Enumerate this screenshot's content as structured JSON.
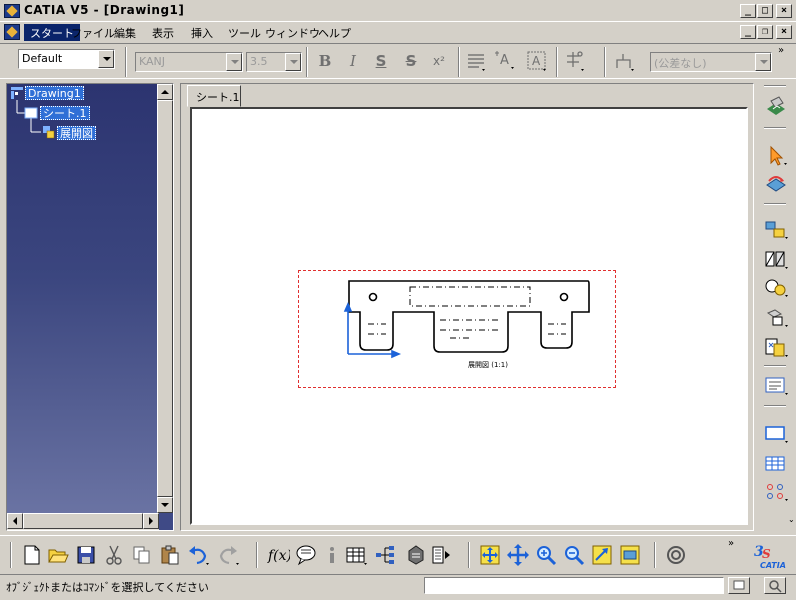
{
  "window": {
    "title": "CATIA V5 - [Drawing1]",
    "min_glyph": "_",
    "max_glyph": "□",
    "close_glyph": "×",
    "doc_restore_glyph": "❐"
  },
  "menu": {
    "items": [
      "スタート",
      "ファイル",
      "編集",
      "表示",
      "挿入",
      "ツール",
      "ウィンドウ",
      "ヘルプ"
    ]
  },
  "format_toolbar": {
    "style_value": "Default",
    "font_value": "KANJ",
    "size_value": "3.5",
    "tolerance_value": "(公差なし)",
    "bold": "B",
    "italic": "I",
    "underline": "S",
    "strike": "S",
    "superscript": "x²",
    "text_frame": "A"
  },
  "tree": {
    "root": "Drawing1",
    "sheet": "シート.1",
    "view": "展開図"
  },
  "drawing": {
    "tab_label": "シート.1",
    "view_label": "展開図  (1:1)",
    "frame_color": "#e03030"
  },
  "status": {
    "prompt": "ｵﾌﾞｼﾞｪｸﾄまたはｺﾏﾝﾄﾞを選択してください",
    "command_value": ""
  },
  "colors": {
    "tree_background": "#3f4a86",
    "selection": "#2f6fd6",
    "axis_blue": "#1c62d8",
    "dashed_frame": "#e03030"
  },
  "icons": {
    "right_toolbar": [
      "workbench-icon",
      "select-arrow-icon",
      "update-icon",
      "views-icon",
      "sections-icon",
      "details-icon",
      "clipping-icon",
      "wizard-icon",
      "frame-icon",
      "table-icon",
      "geometry-creation-icon"
    ],
    "bottom_toolbar": [
      "new-icon",
      "open-icon",
      "save-icon",
      "cut-icon",
      "copy-icon",
      "paste-icon",
      "undo-icon",
      "redo-icon",
      "formula-icon",
      "comment-icon",
      "info-icon",
      "table-icon",
      "tree-icon",
      "catalog-icon",
      "measure-icon",
      "fit-all-icon",
      "pan-icon",
      "zoom-in-icon",
      "zoom-out-icon",
      "normal-view-icon",
      "hide-icon",
      "cycle-icon"
    ]
  }
}
